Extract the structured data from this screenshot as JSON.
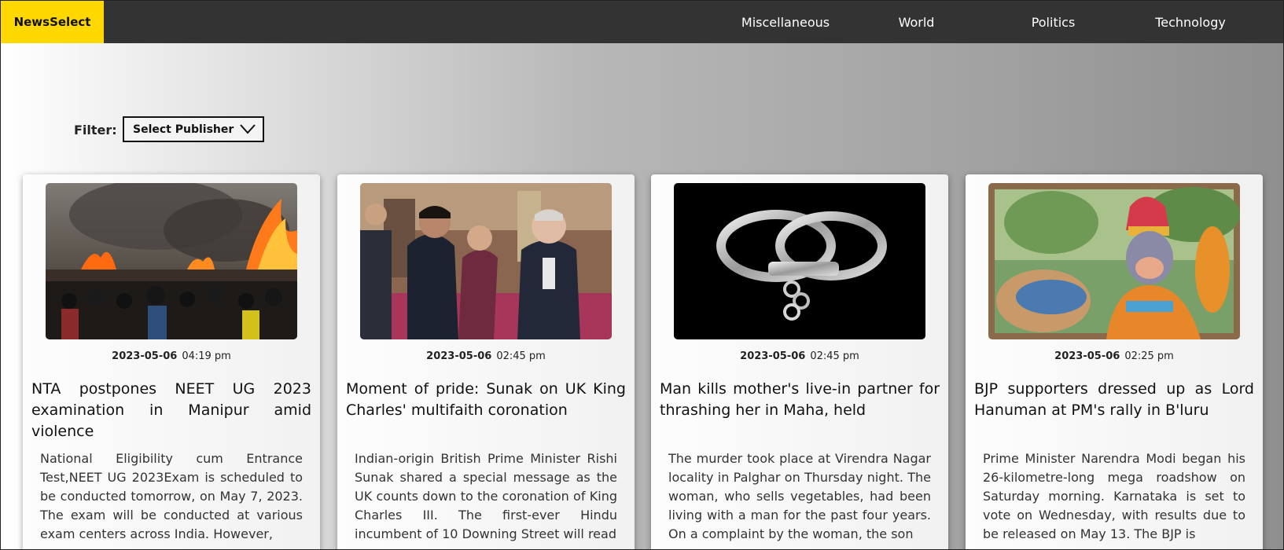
{
  "navbar": {
    "brand": "NewsSelect",
    "links": [
      {
        "label": "Miscellaneous"
      },
      {
        "label": "World"
      },
      {
        "label": "Politics"
      },
      {
        "label": "Technology"
      }
    ]
  },
  "filter": {
    "label": "Filter:",
    "selected": "Select Publisher"
  },
  "colors": {
    "navbar_bg": "#333333",
    "brand_bg": "#ffd800"
  },
  "articles": [
    {
      "date": "2023-05-06",
      "time": "04:19 pm",
      "headline": "NTA postpones NEET UG 2023 examination in Manipur amid violence",
      "summary": "National Eligibility cum Entrance Test,NEET UG 2023Exam is scheduled to be conducted tomorrow, on May 7, 2023. The exam will be conducted at various exam centers across India. However,",
      "image": "fire-scene"
    },
    {
      "date": "2023-05-06",
      "time": "02:45 pm",
      "headline": "Moment of pride: Sunak on UK King Charles' multifaith coronation",
      "summary": "Indian-origin British Prime Minister Rishi Sunak shared a special message as the UK counts down to the coronation of King Charles III. The first-ever Hindu incumbent of 10 Downing Street will read",
      "image": "reception-scene"
    },
    {
      "date": "2023-05-06",
      "time": "02:45 pm",
      "headline": "Man kills mother's live-in partner for thrashing her in Maha, held",
      "summary": "The murder took place at Virendra Nagar locality in Palghar on Thursday night. The woman, who sells vegetables, had been living with a man for the past four years. On a complaint by the woman, the son",
      "image": "handcuffs"
    },
    {
      "date": "2023-05-06",
      "time": "02:25 pm",
      "headline": "BJP supporters dressed up as Lord Hanuman at PM's rally in B'luru",
      "summary": "Prime Minister Narendra Modi began his 26-kilometre-long mega roadshow on Saturday morning. Karnataka is set to vote on Wednesday, with results due to be released on May 13. The BJP is",
      "image": "hanuman-costume"
    }
  ]
}
